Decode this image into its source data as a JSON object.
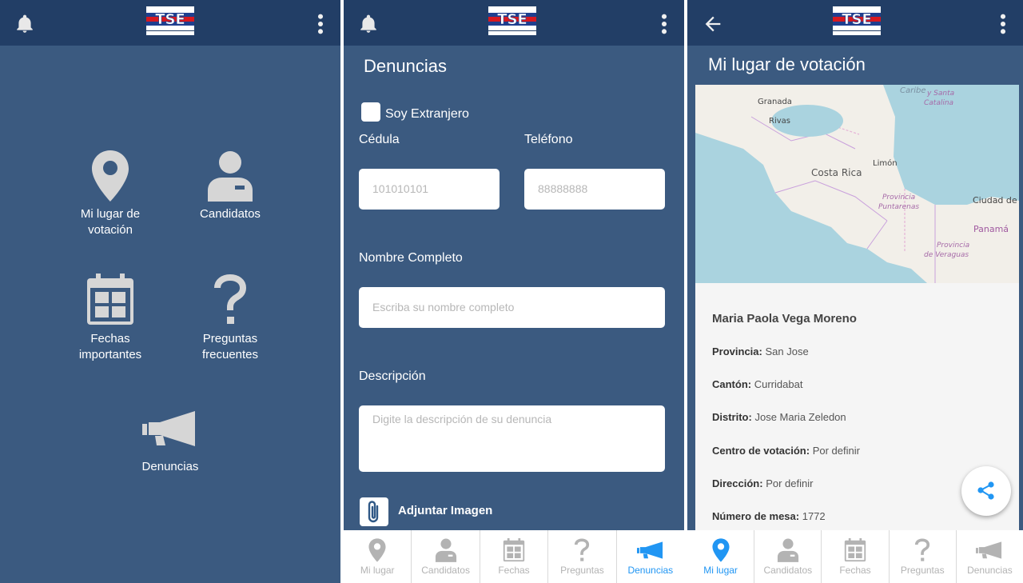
{
  "screen_home": {
    "tiles": [
      {
        "label_line1": "Mi lugar de",
        "label_line2": "votación",
        "icon": "location-pin-icon"
      },
      {
        "label_line1": "Candidatos",
        "label_line2": "",
        "icon": "person-badge-icon"
      },
      {
        "label_line1": "Fechas",
        "label_line2": "importantes",
        "icon": "calendar-icon"
      },
      {
        "label_line1": "Preguntas",
        "label_line2": "frecuentes",
        "icon": "question-mark-icon"
      },
      {
        "label_line1": "Denuncias",
        "label_line2": "",
        "icon": "megaphone-icon"
      }
    ]
  },
  "screen_denuncias": {
    "title": "Denuncias",
    "checkbox_label": "Soy Extranjero",
    "cedula_label": "Cédula",
    "cedula_placeholder": "101010101",
    "telefono_label": "Teléfono",
    "telefono_placeholder": "88888888",
    "nombre_label": "Nombre Completo",
    "nombre_placeholder": "Escriba su nombre completo",
    "descripcion_label": "Descripción",
    "descripcion_placeholder": "Digite la descripción de su denuncia",
    "attach_label": "Adjuntar Imagen"
  },
  "screen_lugar": {
    "title": "Mi lugar de votación",
    "map_labels": {
      "granada": "Granada",
      "rivas": "Rivas",
      "caribe": "Caribe",
      "costa_rica": "Costa Rica",
      "limon": "Limón",
      "puntarenas_1": "Provincia",
      "puntarenas_2": "Puntarenas",
      "ciudad": "Ciudad de",
      "panama": "Panamá",
      "veraguas_1": "Provincia",
      "veraguas_2": "de Veraguas",
      "santa_1": "y Santa",
      "santa_2": "Catalina"
    },
    "person_name": "Maria Paola Vega Moreno",
    "rows": [
      {
        "key": "Provincia:",
        "value": "San Jose"
      },
      {
        "key": "Cantón:",
        "value": "Curridabat"
      },
      {
        "key": "Distrito:",
        "value": "Jose Maria Zeledon"
      },
      {
        "key": "Centro de votación:",
        "value": "Por definir"
      },
      {
        "key": "Dirección:",
        "value": "Por definir"
      },
      {
        "key": "Número de mesa:",
        "value": "1772"
      }
    ]
  },
  "bottom_nav": [
    {
      "label": "Mi lugar",
      "icon": "location-pin-icon"
    },
    {
      "label": "Candidatos",
      "icon": "person-badge-icon"
    },
    {
      "label": "Fechas",
      "icon": "calendar-icon"
    },
    {
      "label": "Preguntas",
      "icon": "question-mark-icon"
    },
    {
      "label": "Denuncias",
      "icon": "megaphone-icon"
    }
  ],
  "colors": {
    "background": "#3b5a80",
    "appbar": "#223e66",
    "icon_gray": "#d6d6d6",
    "nav_active": "#2196f3",
    "nav_inactive": "#b3b3b3"
  }
}
